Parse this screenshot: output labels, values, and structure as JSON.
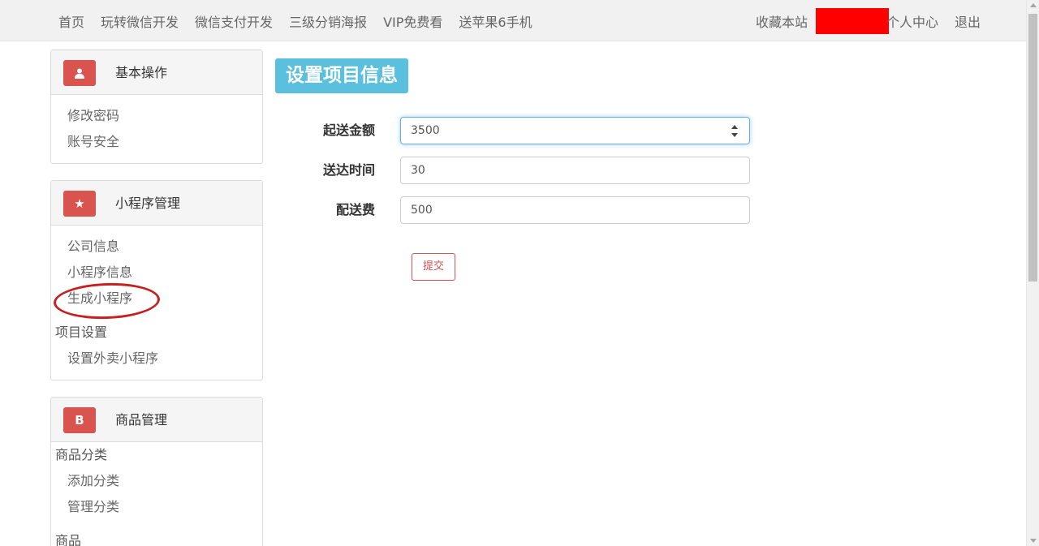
{
  "nav": {
    "left": [
      "首页",
      "玩转微信开发",
      "微信支付开发",
      "三级分销海报",
      "VIP免费看",
      "送苹果6手机"
    ],
    "favorite": "收藏本站",
    "profile": "个人中心",
    "logout": "退出"
  },
  "sidebar": {
    "basic": {
      "title": "基本操作",
      "icon": "user-icon",
      "items": [
        "修改密码",
        "账号安全"
      ]
    },
    "mini": {
      "title": "小程序管理",
      "icon": "star-icon",
      "items": [
        "公司信息",
        "小程序信息",
        "生成小程序"
      ],
      "group": "项目设置",
      "group_items": [
        "设置外卖小程序"
      ]
    },
    "goods": {
      "title": "商品管理",
      "icon": "bitcoin-icon",
      "group1": "商品分类",
      "group1_items": [
        "添加分类",
        "管理分类"
      ],
      "group2": "商品"
    }
  },
  "main": {
    "title": "设置项目信息",
    "fields": {
      "amount": {
        "label": "起送金额",
        "value": "3500"
      },
      "time": {
        "label": "送达时间",
        "value": "30"
      },
      "fee": {
        "label": "配送费",
        "value": "500"
      }
    },
    "submit": "提交"
  },
  "colors": {
    "accent": "#5bc0de",
    "danger": "#d9534f",
    "highlight_ring": "#c62020",
    "redaction": "#ff0000"
  }
}
